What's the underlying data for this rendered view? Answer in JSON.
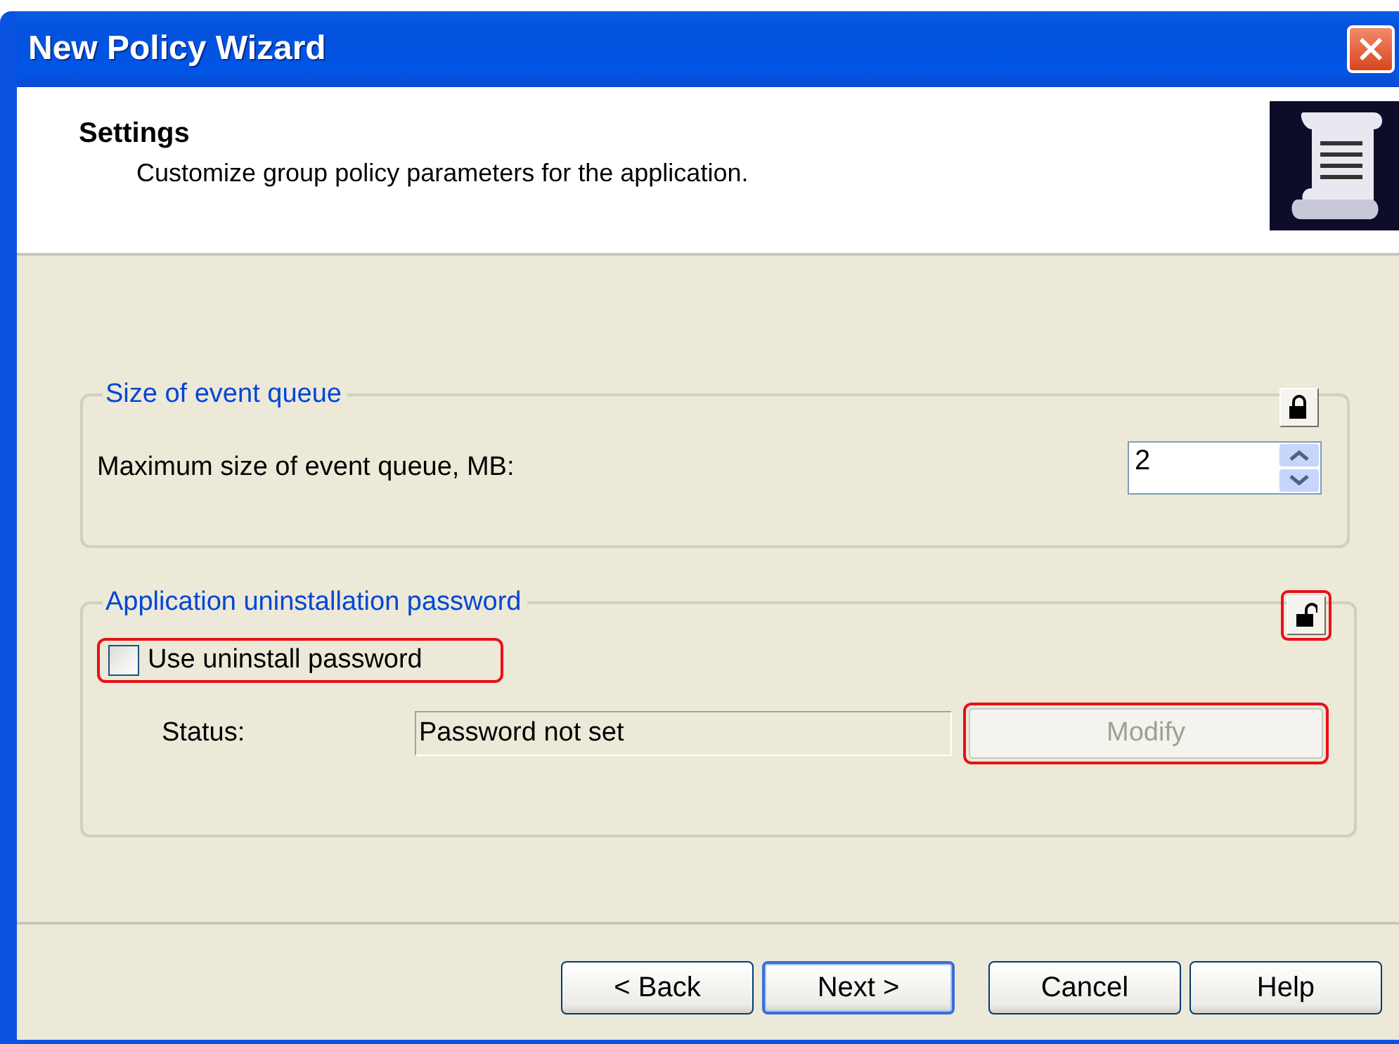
{
  "window": {
    "title": "New Policy Wizard"
  },
  "header": {
    "title": "Settings",
    "subtitle": "Customize group policy parameters for the application."
  },
  "groups": [
    {
      "kind": "spin",
      "title": "Size of event queue",
      "locked": true,
      "lock_highlighted": false,
      "label": "Maximum size of event queue, MB:",
      "value": "2"
    },
    {
      "kind": "password",
      "title": "Application uninstallation password",
      "locked": false,
      "lock_highlighted": true,
      "checkbox": {
        "label": "Use uninstall password",
        "checked": false,
        "highlighted": true
      },
      "status_label": "Status:",
      "status_value": "Password not set",
      "button": {
        "label": "Modify",
        "disabled": true,
        "highlighted": true
      }
    }
  ],
  "buttons": [
    {
      "label": "< Back",
      "default": false
    },
    {
      "label": "Next >",
      "default": true
    },
    {
      "label": "Cancel",
      "default": false
    },
    {
      "label": "Help",
      "default": false
    }
  ]
}
